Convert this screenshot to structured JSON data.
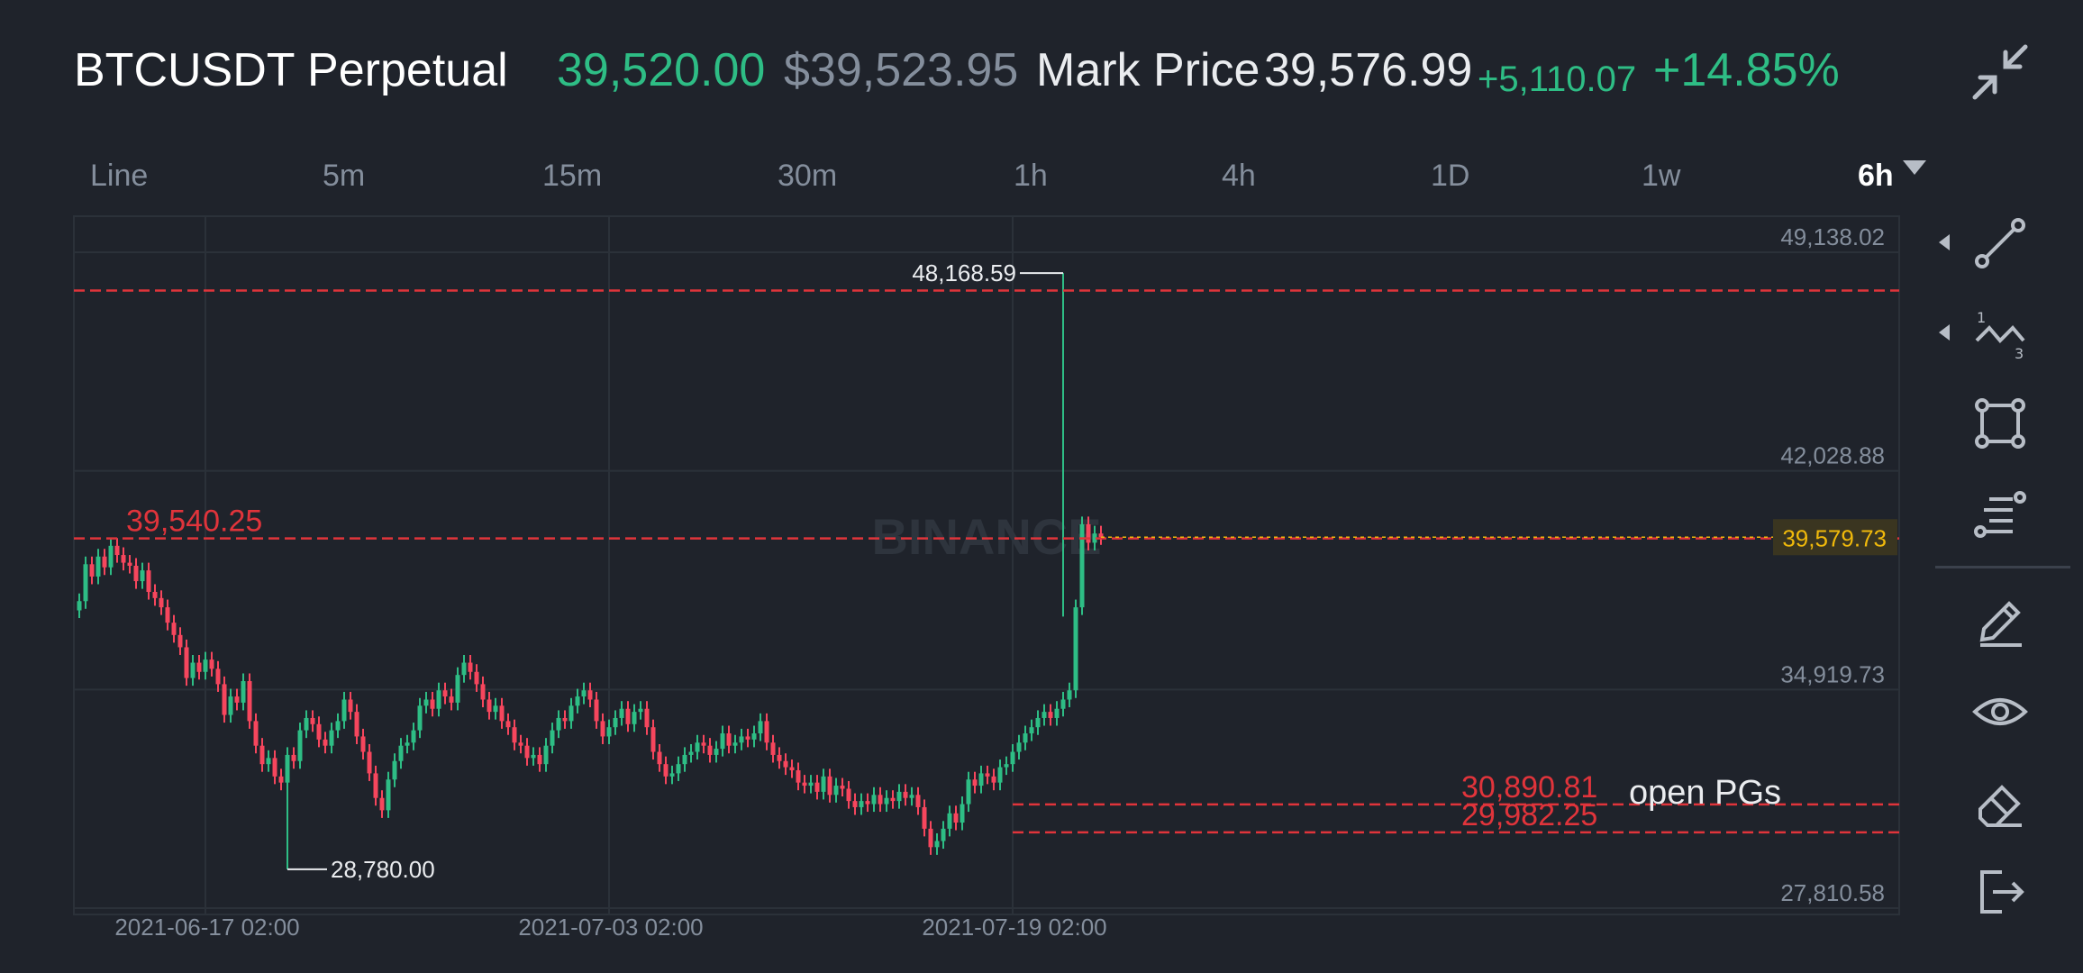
{
  "header": {
    "symbol": "BTCUSDT Perpetual",
    "last_price": "39,520.00",
    "usd_price": "$39,523.95",
    "mark_price_label": "Mark Price",
    "mark_price": "39,576.99",
    "change_abs": "+5,110.07",
    "change_pct": "+14.85%"
  },
  "intervals": [
    "Line",
    "5m",
    "15m",
    "30m",
    "1h",
    "4h",
    "1D",
    "1w",
    "6h"
  ],
  "active_interval": "6h",
  "tools": [
    "trend-line-icon",
    "wave-pattern-icon",
    "rectangle-shape-icon",
    "fib-retracement-icon",
    "pencil-icon",
    "eye-icon",
    "eraser-icon",
    "exit-icon"
  ],
  "colors": {
    "up": "#2ebd85",
    "down": "#f6465d",
    "alert_line": "#e0343b",
    "current_price": "#f0b90b",
    "background": "#1f232b"
  },
  "chart_data": {
    "type": "candlestick",
    "watermark": "BINANCE",
    "ylim": [
      27810.58,
      49138.02
    ],
    "y_ticks": [
      "49,138.02",
      "42,028.88",
      "34,919.73",
      "27,810.58"
    ],
    "y_tick_values": [
      49138.02,
      42028.88,
      34919.73,
      27810.58
    ],
    "x_ticks": [
      "2021-06-17 02:00",
      "2021-07-03 02:00",
      "2021-07-19 02:00"
    ],
    "x_tick_index": [
      20,
      84,
      148
    ],
    "current_price_label": "39,579.73",
    "current_price": 39579.73,
    "high_label": "48,168.59",
    "high_value": 48168.59,
    "low_label": "28,780.00",
    "low_value": 28780.0,
    "price_lines": [
      {
        "value": 47600,
        "label": ""
      },
      {
        "value": 39540.25,
        "label": "39,540.25"
      },
      {
        "value": 30890.81,
        "label": "30,890.81"
      },
      {
        "value": 29982.25,
        "label": "29,982.25"
      }
    ],
    "annotation": "open PGs",
    "closes": [
      37500,
      38700,
      38300,
      38950,
      38600,
      39300,
      39000,
      38750,
      38650,
      38150,
      38500,
      37800,
      37600,
      37300,
      36800,
      36400,
      36000,
      35000,
      35500,
      35200,
      35600,
      35300,
      34800,
      33800,
      34400,
      34200,
      34900,
      33600,
      32800,
      32200,
      32400,
      31800,
      31600,
      32500,
      32300,
      33300,
      33700,
      33500,
      33000,
      32800,
      33300,
      33600,
      34300,
      33900,
      33100,
      32600,
      31900,
      31100,
      30700,
      31700,
      32300,
      32800,
      32900,
      33300,
      34100,
      34300,
      34000,
      34600,
      34400,
      34200,
      35100,
      35500,
      35200,
      34800,
      34300,
      33900,
      34100,
      33600,
      33400,
      32900,
      32800,
      32400,
      32500,
      32200,
      32800,
      33300,
      33700,
      33600,
      34100,
      34400,
      34600,
      34300,
      33600,
      33100,
      33400,
      33700,
      34000,
      33500,
      33900,
      34000,
      33400,
      32600,
      32200,
      31800,
      31900,
      32200,
      32500,
      32600,
      32900,
      32800,
      32500,
      32700,
      33200,
      32800,
      32900,
      33100,
      33000,
      33200,
      33600,
      32900,
      32500,
      32300,
      32100,
      32000,
      31600,
      31500,
      31600,
      31300,
      31800,
      31200,
      31500,
      31400,
      31000,
      30800,
      31000,
      30900,
      31200,
      30900,
      31100,
      31000,
      31300,
      31100,
      31200,
      30800,
      30100,
      29500,
      29700,
      30100,
      30600,
      30300,
      30900,
      31700,
      31500,
      31900,
      31800,
      31600,
      32100,
      32200,
      32600,
      32900,
      33200,
      33400,
      33700,
      33900,
      33700,
      34000,
      34300,
      34600,
      37300,
      40000,
      39400,
      39700,
      39580
    ]
  }
}
